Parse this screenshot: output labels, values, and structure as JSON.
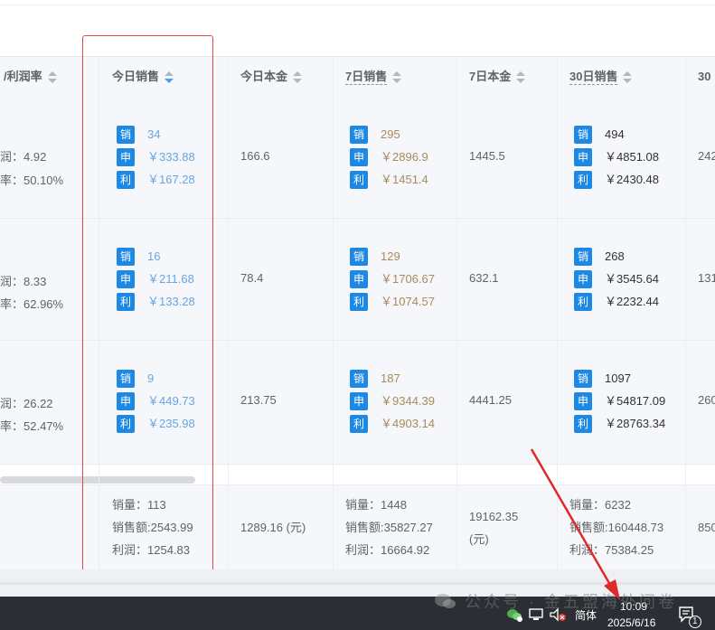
{
  "header": {
    "col_profit_rate": "/利润率",
    "col_today_sales": "今日销售",
    "col_today_cost": "今日本金",
    "col_7d_sales": "7日销售",
    "col_7d_cost": "7日本金",
    "col_30d_sales": "30日销售",
    "col_30_cut": "30"
  },
  "tags": {
    "sales": "销",
    "declared": "申",
    "profit": "利"
  },
  "rows": [
    {
      "left_a": "润：4.92",
      "left_b": "率：50.10%",
      "today": {
        "qty": "34",
        "amount": "￥333.88",
        "profit": "￥167.28"
      },
      "today_cost": "166.6",
      "d7": {
        "qty": "295",
        "amount": "￥2896.9",
        "profit": "￥1451.4"
      },
      "d7_cost": "1445.5",
      "d30": {
        "qty": "494",
        "amount": "￥4851.08",
        "profit": "￥2430.48"
      },
      "edge": "242"
    },
    {
      "left_a": "润：8.33",
      "left_b": "率：62.96%",
      "today": {
        "qty": "16",
        "amount": "￥211.68",
        "profit": "￥133.28"
      },
      "today_cost": "78.4",
      "d7": {
        "qty": "129",
        "amount": "￥1706.67",
        "profit": "￥1074.57"
      },
      "d7_cost": "632.1",
      "d30": {
        "qty": "268",
        "amount": "￥3545.64",
        "profit": "￥2232.44"
      },
      "edge": "131"
    },
    {
      "left_a": "润：26.22",
      "left_b": "率：52.47%",
      "today": {
        "qty": "9",
        "amount": "￥449.73",
        "profit": "￥235.98"
      },
      "today_cost": "213.75",
      "d7": {
        "qty": "187",
        "amount": "￥9344.39",
        "profit": "￥4903.14"
      },
      "d7_cost": "4441.25",
      "d30": {
        "qty": "1097",
        "amount": "￥54817.09",
        "profit": "￥28763.34"
      },
      "edge": "260"
    }
  ],
  "footer": {
    "today": {
      "qty": "销量：113",
      "amount": "销售额:2543.99",
      "profit": "利润：1254.83"
    },
    "today_cost": "1289.16 (元)",
    "d7": {
      "qty": "销量：1448",
      "amount": "销售额:35827.27",
      "profit": "利润：16664.92"
    },
    "d7_cost_a": "19162.35",
    "d7_cost_b": "(元)",
    "d30": {
      "qty": "销量：6232",
      "amount": "销售额:160448.73",
      "profit": "利润：75384.25"
    },
    "edge": "850"
  },
  "watermark": "公众号 · 金五盟海外问卷",
  "taskbar": {
    "ime": "简体",
    "time": "10:09",
    "date": "2025/6/16",
    "notif": "1"
  },
  "colors": {
    "tag": "#1e88e5",
    "highlight": "#e0484d",
    "today_text": "#66a6e4",
    "d7_text": "#a88a5c"
  }
}
